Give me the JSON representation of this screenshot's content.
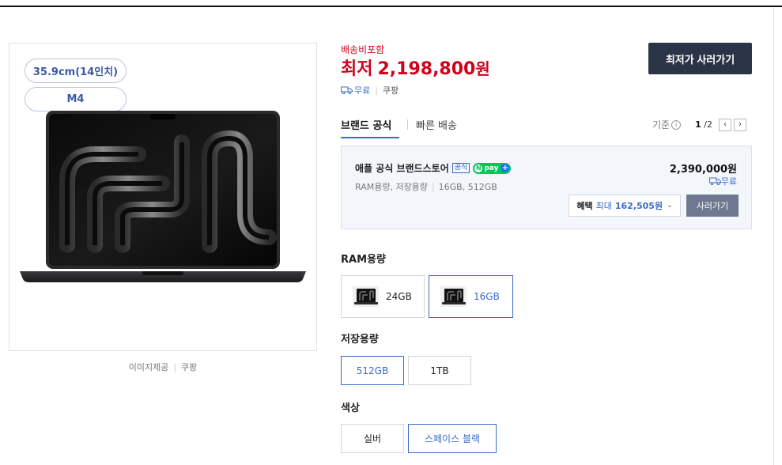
{
  "product_image": {
    "badges": [
      "35.9cm(14인치)",
      "M4"
    ],
    "source_label": "이미지제공",
    "source_name": "쿠팡"
  },
  "pricing": {
    "shipping_note": "배송비포함",
    "price_prefix": "최저",
    "price": "2,198,800",
    "price_unit": "원",
    "delivery_free": "무료",
    "seller": "쿠팡",
    "buy_lowest_button": "최저가 사러가기"
  },
  "tabs": [
    {
      "label": "브랜드 공식",
      "active": true
    },
    {
      "label": "빠른 배송",
      "active": false
    }
  ],
  "pager": {
    "criteria_label": "기준",
    "current": "1",
    "total": "/2"
  },
  "store_offer": {
    "name": "애플 공식 브랜드스토어",
    "official_tag": "공식",
    "npay_label": "pay",
    "specs": [
      "RAM용량, 저장용량",
      "16GB, 512GB"
    ],
    "price": "2,390,000원",
    "shipping": "무료",
    "benefit_label": "혜택",
    "benefit_max": "최대",
    "benefit_amount": "162,505원",
    "buy_button": "사러가기"
  },
  "options": {
    "ram": {
      "label": "RAM용량",
      "items": [
        {
          "label": "24GB",
          "selected": false
        },
        {
          "label": "16GB",
          "selected": true
        }
      ]
    },
    "storage": {
      "label": "저장용량",
      "items": [
        {
          "label": "512GB",
          "selected": true
        },
        {
          "label": "1TB",
          "selected": false
        }
      ]
    },
    "color": {
      "label": "색상",
      "items": [
        {
          "label": "실버",
          "selected": false
        },
        {
          "label": "스페이스 블랙",
          "selected": true
        }
      ]
    }
  },
  "colors": {
    "price_red": "#d0021b",
    "accent_blue": "#3a6cc8",
    "dark_button": "#2b3447",
    "npay_green": "#03c75a"
  }
}
